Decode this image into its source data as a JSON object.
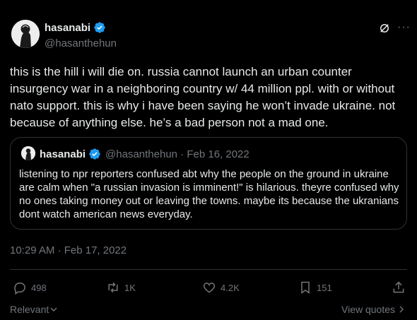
{
  "tweet": {
    "author_name": "hasanabi",
    "author_handle": "@hasanthehun",
    "text": "this is the hill i will die on. russia cannot launch an urban counter insurgency war in a neighboring country w/ 44 million ppl. with or without nato support. this is why i have been saying he won’t invade ukraine. not because of anything else. he’s a bad person not a mad one.",
    "timestamp": "10:29 AM · Feb 17, 2022"
  },
  "quoted": {
    "author_name": "hasanabi",
    "meta": "@hasanthehun · Feb 16, 2022",
    "text": "listening to npr reporters confused abt why the people on the ground in ukraine are calm when \"a russian invasion is imminent!\" is hilarious. theyre confused why no ones taking money out or leaving the towns. maybe its because the ukranians dont watch american news everyday."
  },
  "actions": {
    "replies": "498",
    "reposts": "1K",
    "likes": "4.2K",
    "bookmarks": "151"
  },
  "footer": {
    "relevant_label": "Relevant",
    "view_quotes_label": "View quotes"
  },
  "colors": {
    "background": "#000000",
    "text": "#e7e9ea",
    "muted": "#71767b",
    "verified": "#1d9bf0",
    "border": "#2f3336"
  }
}
